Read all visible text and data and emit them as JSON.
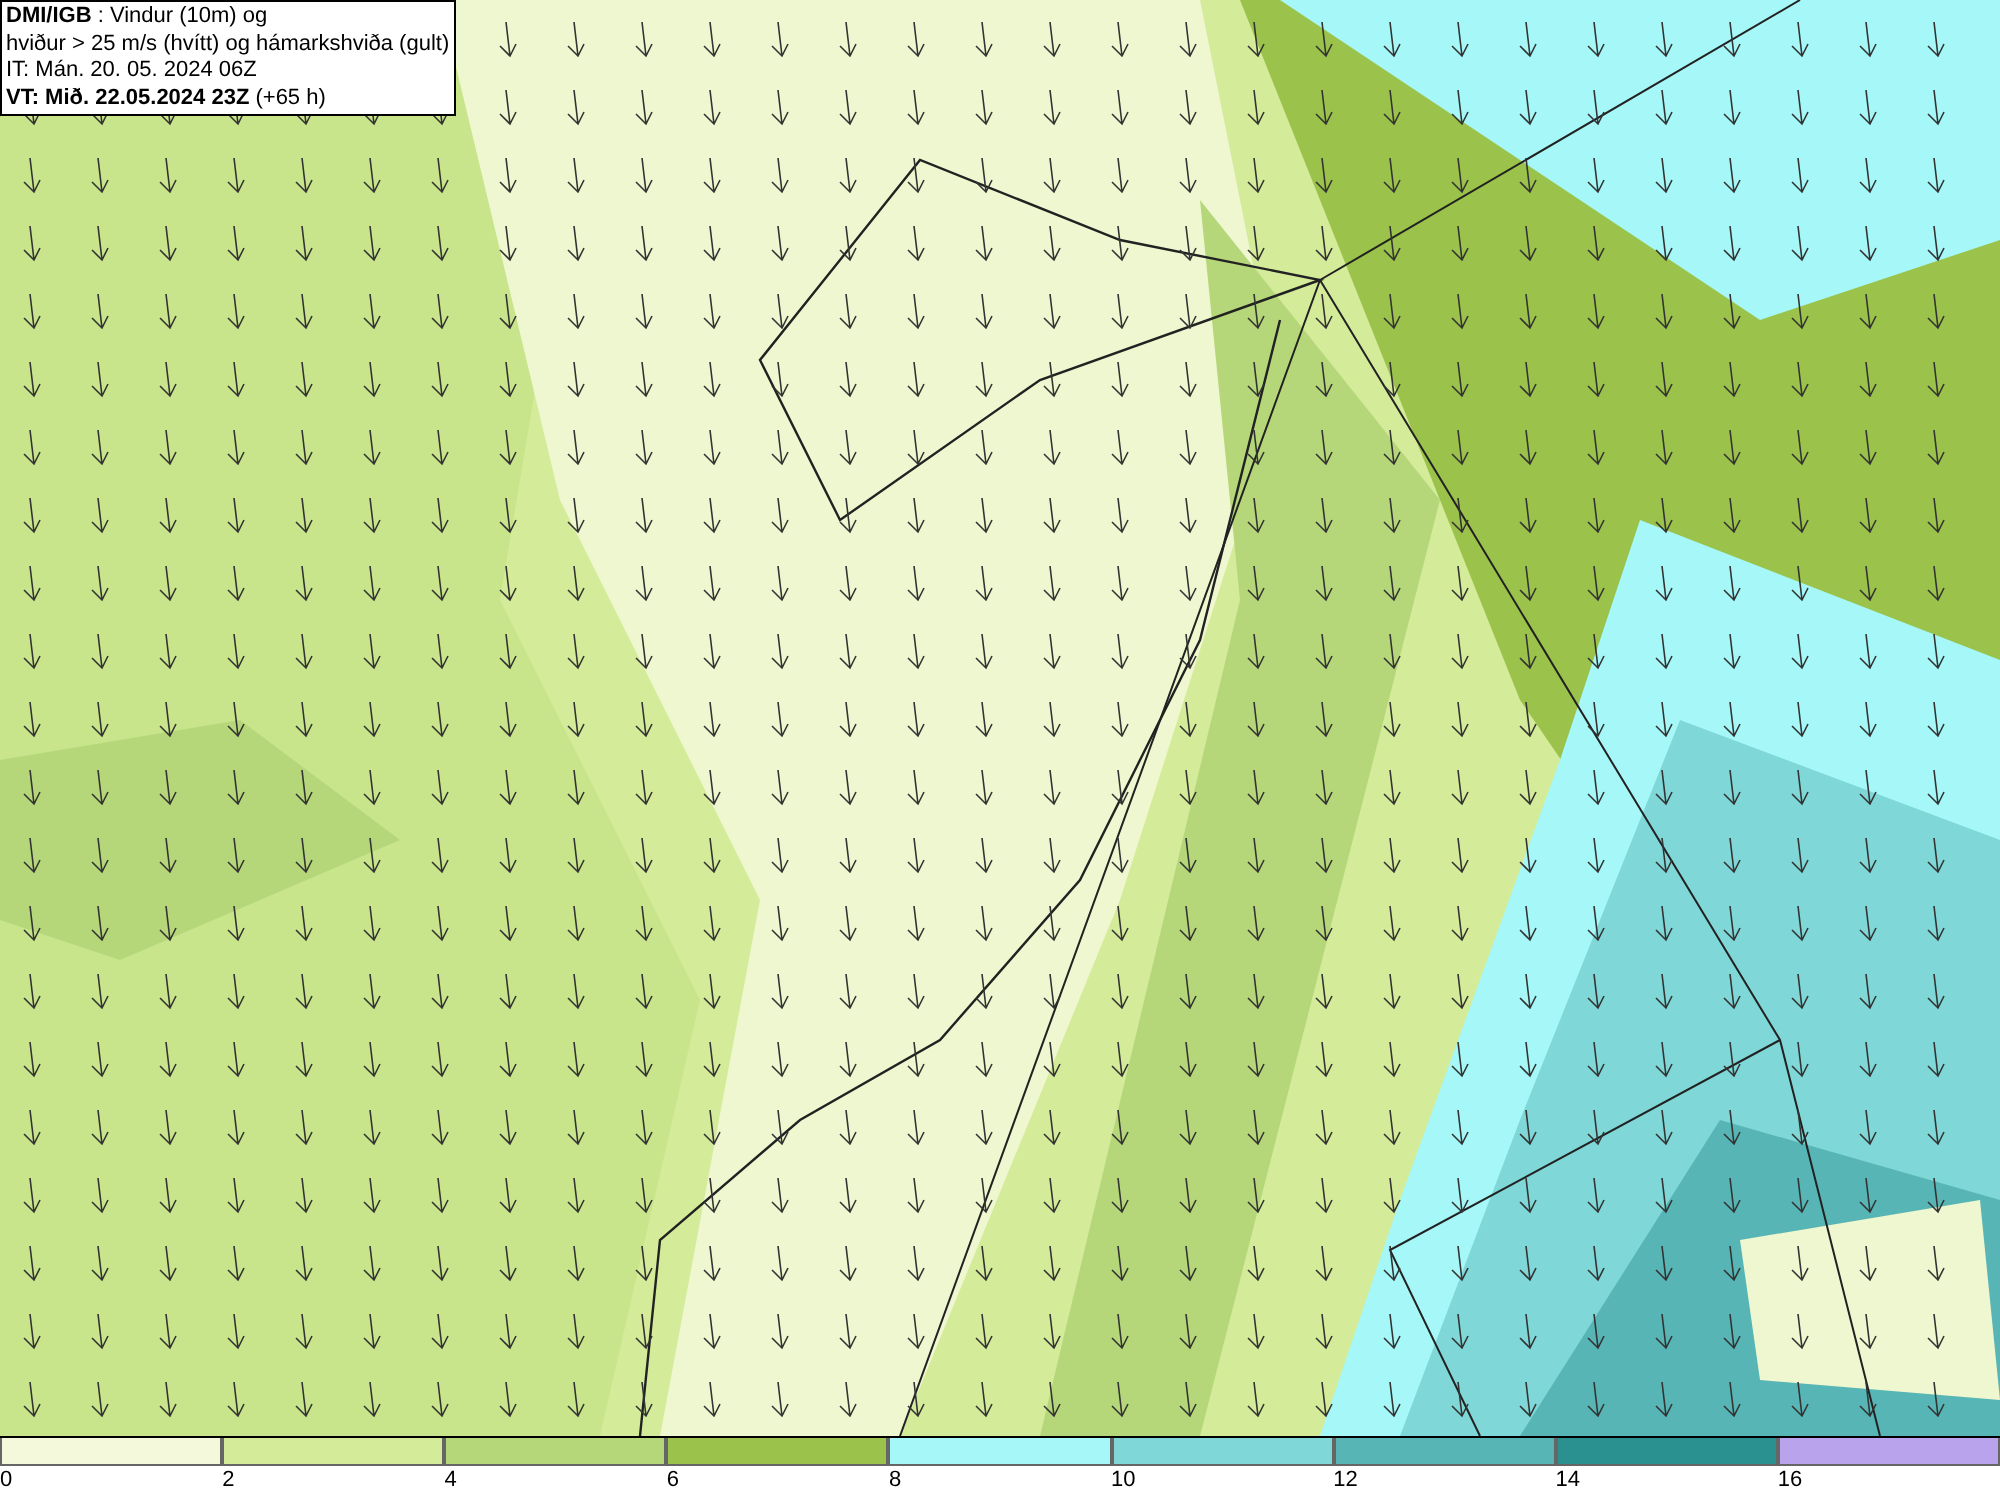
{
  "header": {
    "lines": [
      "**DMI/IGB** : Vindur (10m) og",
      "hviður > 25 m/s (hvítt) og hámarkshviða (gult)",
      "IT: Mán. 20. 05. 2024 06Z",
      "**VT: Mið. 22.05.2024 23Z** (+65 h)"
    ]
  },
  "colorbar": [
    {
      "color": "#f4f9dc",
      "label": "0"
    },
    {
      "color": "#d4eb9a",
      "label": "2"
    },
    {
      "color": "#b5d77a",
      "label": "4"
    },
    {
      "color": "#9bc24a",
      "label": "6"
    },
    {
      "color": "#a6f8f8",
      "label": "8"
    },
    {
      "color": "#7fd7d7",
      "label": "10"
    },
    {
      "color": "#57b5b5",
      "label": "12"
    },
    {
      "color": "#2a9090",
      "label": "14"
    },
    {
      "color": "#b9a3ec",
      "label": "16"
    }
  ]
}
